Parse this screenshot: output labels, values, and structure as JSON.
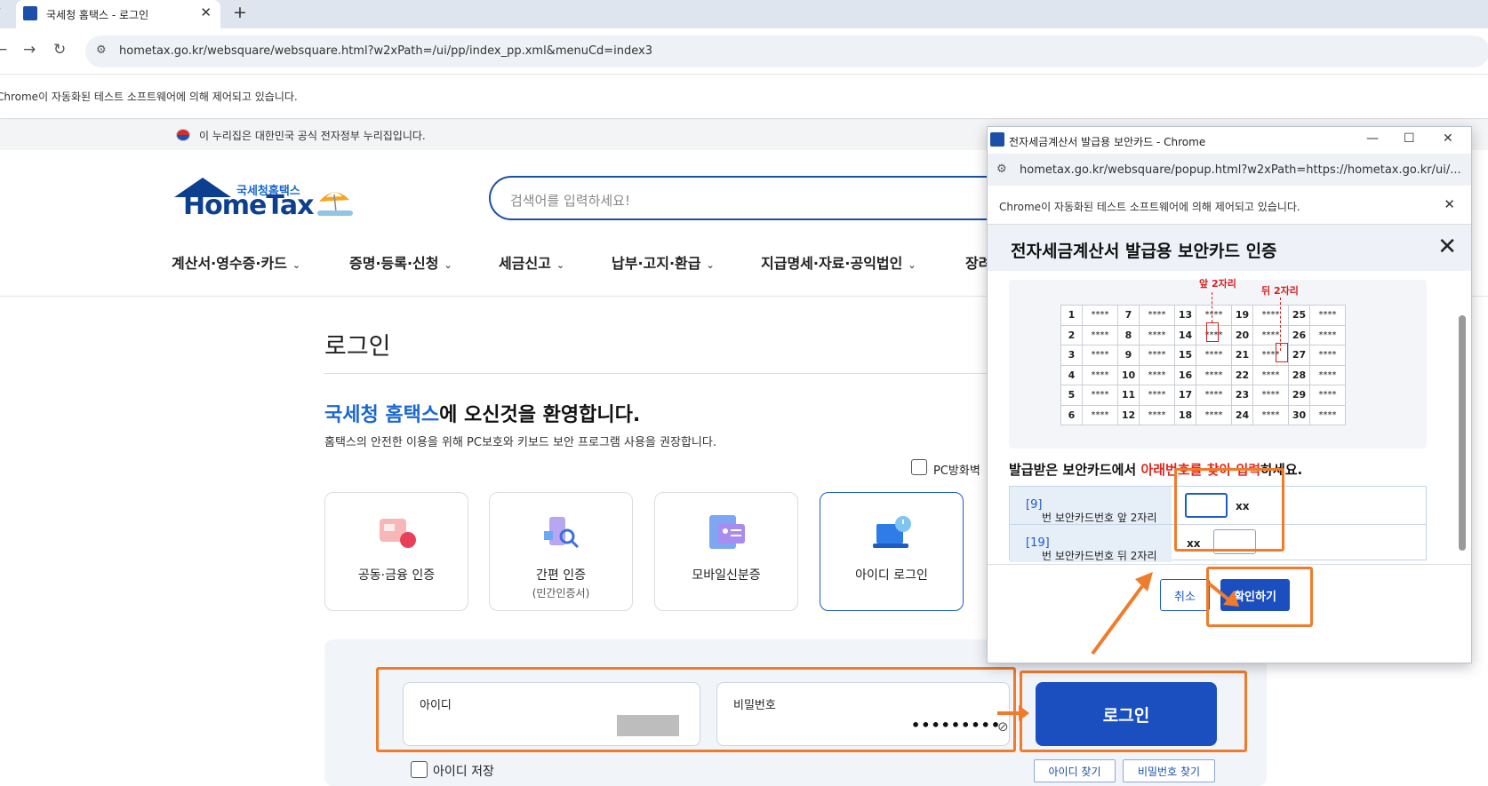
{
  "browser": {
    "tab_title": "국세청 홈택스 - 로그인",
    "tab_close": "✕",
    "new_tab": "+",
    "url": "hometax.go.kr/websquare/websquare.html?w2xPath=/ui/pp/index_pp.xml&menuCd=index3",
    "automation_notice": "Chrome이 자동화된 테스트 소프트웨어에 의해 제어되고 있습니다.",
    "back": "←",
    "forward": "→",
    "reload": "↻"
  },
  "gov_banner": "이 누리집은 대한민국 공식 전자정부 누리집입니다.",
  "logo": {
    "top": "국세청홈택스",
    "main": "HomeTax"
  },
  "search": {
    "placeholder": "검색어를 입력하세요!"
  },
  "menu": [
    "계산서·영수증·카드",
    "증명·등록·신청",
    "세금신고",
    "납부·고지·환급",
    "지급명세·자료·공익법인",
    "장려"
  ],
  "login": {
    "title": "로그인",
    "welcome_highlight": "국세청 홈택스",
    "welcome_rest": "에 오신것을 환영합니다.",
    "subtext": "홈택스의 안전한 이용을 위해 PC보호와 키보드 보안 프로그램 사용을 권장합니다.",
    "pc_room_label": "PC방화벽",
    "methods": [
      {
        "label": "공동·금융 인증",
        "sub": ""
      },
      {
        "label": "간편 인증",
        "sub": "(민간인증서)"
      },
      {
        "label": "모바일신분증",
        "sub": ""
      },
      {
        "label": "아이디 로그인",
        "sub": ""
      }
    ],
    "id_label": "아이디",
    "pw_label": "비밀번호",
    "pw_value": "•••••••••",
    "login_button": "로그인",
    "save_id_label": "아이디 저장",
    "find_id": "아이디 찾기",
    "find_pw": "비밀번호 찾기"
  },
  "popup": {
    "window_title": "전자세금계산서 발급용 보안카드 - Chrome",
    "url": "hometax.go.kr/websquare/popup.html?w2xPath=https://hometax.go.kr/ui/...",
    "automation_notice": "Chrome이 자동화된 테스트 소프트웨어에 의해 제어되고 있습니다.",
    "heading": "전자세금계산서 발급용 보안카드 인증",
    "front_label": "앞 2자리",
    "back_label": "뒤 2자리",
    "card_cell": "****",
    "card_numbers": [
      [
        "1",
        "7",
        "13",
        "19",
        "25"
      ],
      [
        "2",
        "8",
        "14",
        "20",
        "26"
      ],
      [
        "3",
        "9",
        "15",
        "21",
        "27"
      ],
      [
        "4",
        "10",
        "16",
        "22",
        "28"
      ],
      [
        "5",
        "11",
        "17",
        "23",
        "29"
      ],
      [
        "6",
        "12",
        "18",
        "24",
        "30"
      ]
    ],
    "instruction_pre": "발급받은 보안카드에서 ",
    "instruction_red": "아래번호를 찾아 입력",
    "instruction_post": "하세요.",
    "row1_num": "[9]",
    "row1_text": "번 보안카드번호 앞 2자리",
    "row2_num": "[19]",
    "row2_text": "번 보안카드번호 뒤 2자리",
    "xx": "xx",
    "cancel": "취소",
    "confirm": "확인하기"
  },
  "colors": {
    "brand": "#1b4fbf",
    "highlight": "#f07b2a",
    "accent_red": "#d61f1f"
  }
}
